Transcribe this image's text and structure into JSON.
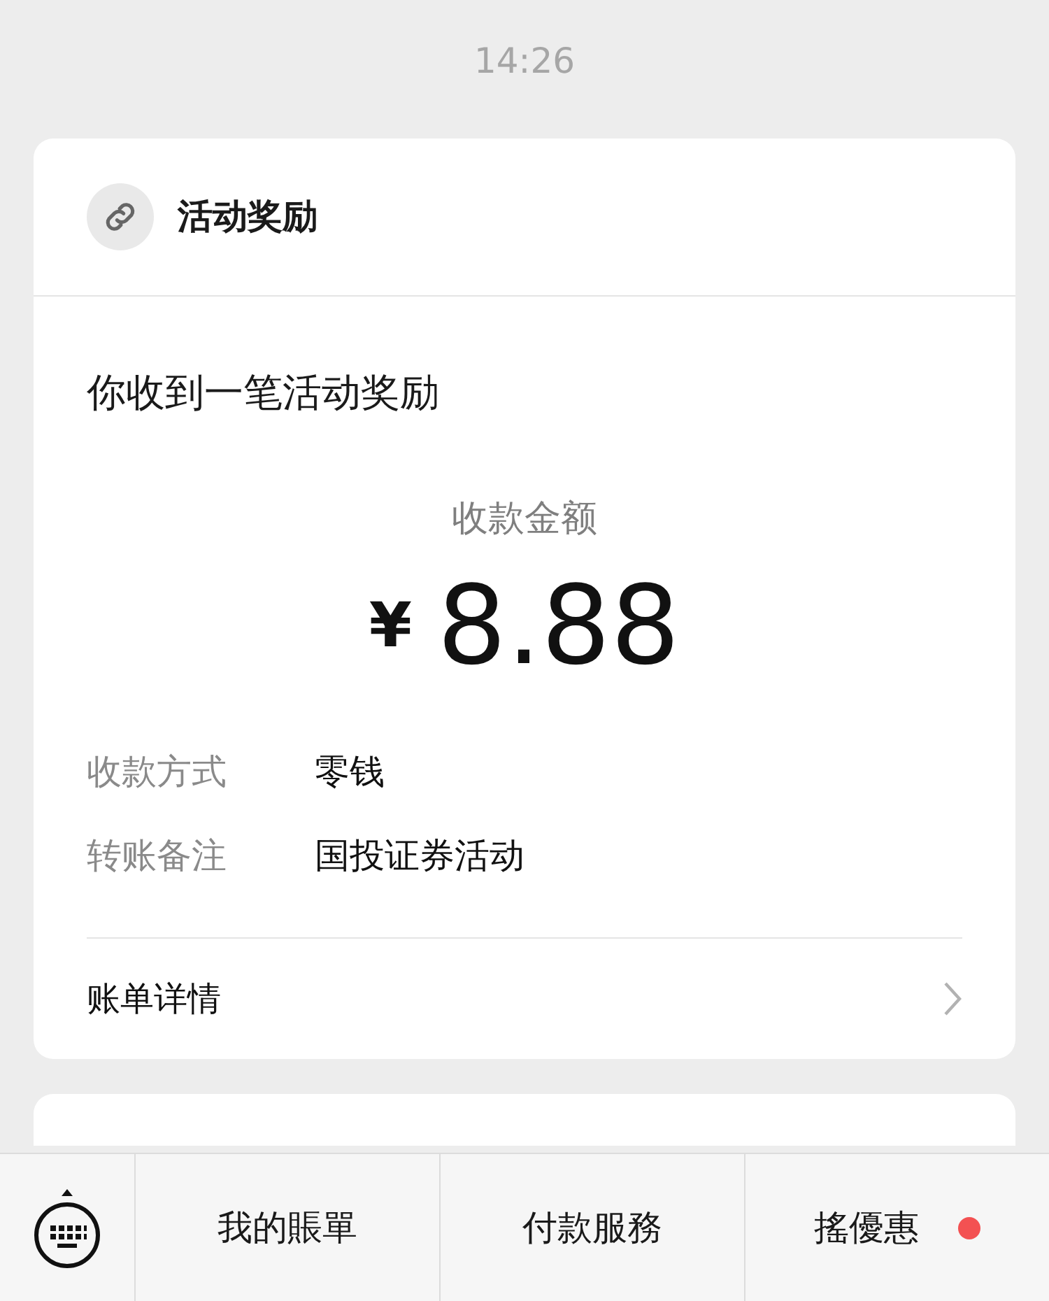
{
  "time": "14:26",
  "card": {
    "source": "活动奖励",
    "title": "你收到一笔活动奖励",
    "amount_label": "收款金额",
    "currency": "¥",
    "amount": "8.88",
    "details": [
      {
        "label": "收款方式",
        "value": "零钱"
      },
      {
        "label": "转账备注",
        "value": "国投证券活动"
      }
    ],
    "link": "账单详情"
  },
  "menu": [
    {
      "label": "我的賬單",
      "dot": false
    },
    {
      "label": "付款服務",
      "dot": false
    },
    {
      "label": "搖優惠",
      "dot": true
    }
  ]
}
